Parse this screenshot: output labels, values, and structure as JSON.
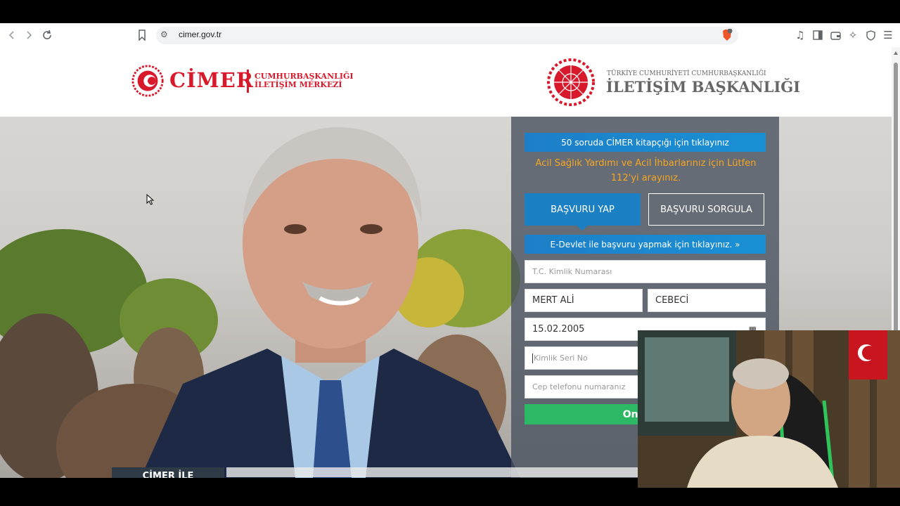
{
  "browser": {
    "url": "cimer.gov.tr",
    "brave_badge": "2"
  },
  "header": {
    "cimer_brand": "CİMER",
    "cimer_sub_line1": "CUMHURBAŞKANLIĞI",
    "cimer_sub_line2": "İLETİŞİM MERKEZİ",
    "iletisim_small": "TÜRKİYE CUMHURİYETİ CUMHURBAŞKANLIĞI",
    "iletisim_big": "İLETİŞİM BAŞKANLIĞI"
  },
  "panel": {
    "kitap_link": "50 soruda CİMER kitapçığı için tıklayınız",
    "warning": "Acil Sağlık Yardımı ve Acil İhbarlarınız için Lütfen 112'yi arayınız.",
    "tab_basvuru_yap": "BAŞVURU YAP",
    "tab_basvuru_sorgula": "BAŞVURU SORGULA",
    "edevlet_link": "E-Devlet ile başvuru yapmak için tıklayınız. »",
    "tc_placeholder": "T.C. Kimlik Numarası",
    "ad_value": "MERT ALİ",
    "soyad_value": "CEBECİ",
    "dob_value": "15.02.2005",
    "seri_placeholder": "Kimlik Seri No",
    "tel_placeholder": "Cep telefonu numaranız",
    "onay_button": "Onay ko"
  },
  "bottom": {
    "cimer_ile": "CİMER İLE"
  },
  "colors": {
    "brand_red": "#d7192b",
    "button_blue": "#1b7fc4",
    "warning_orange": "#f5a623",
    "onay_green": "#2cb864"
  },
  "icons": [
    "back-icon",
    "forward-icon",
    "reload-icon",
    "bookmark-icon",
    "site-settings-icon",
    "brave-shield-icon",
    "music-icon",
    "sidebar-icon",
    "wallet-icon",
    "leo-icon",
    "vpn-icon",
    "menu-icon",
    "calendar-icon",
    "mouse-cursor-icon"
  ]
}
